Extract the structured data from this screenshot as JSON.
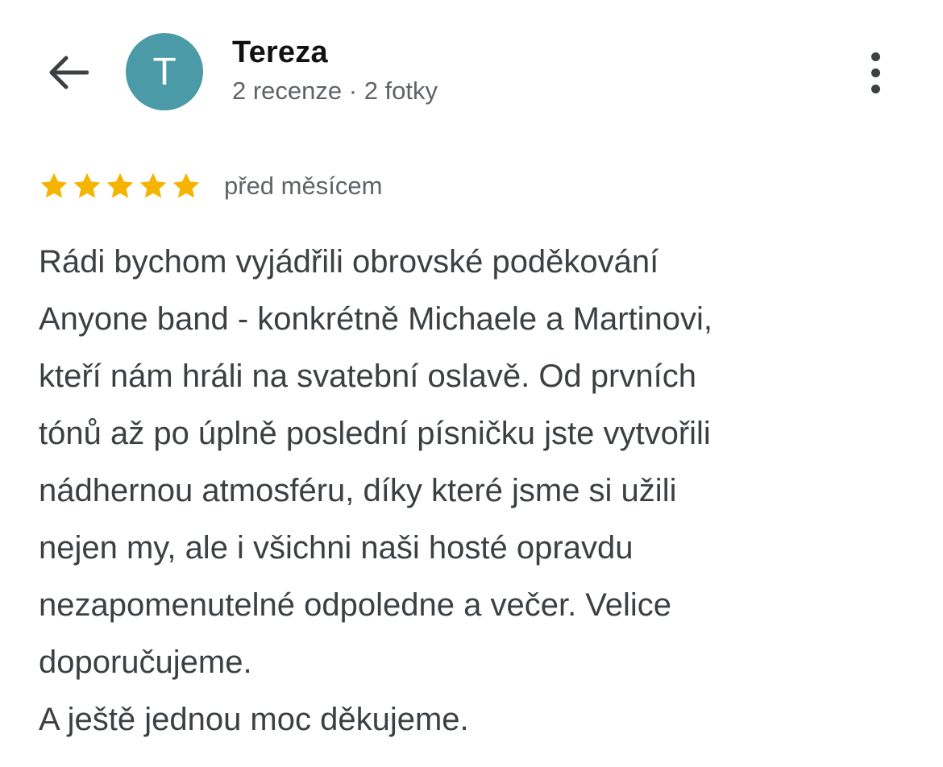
{
  "header": {
    "user_name": "Tereza",
    "avatar_letter": "T",
    "avatar_color": "#4a9aa8",
    "meta": "2 recenze · 2 fotky",
    "back_icon": "arrow-back-icon",
    "more_icon": "more-vert-icon"
  },
  "review": {
    "rating": 5,
    "max_rating": 5,
    "star_color": "#f4b400",
    "date": "před měsícem",
    "lines": [
      "Rádi bychom vyjádřili obrovské poděkování",
      "Anyone band - konkrétně Michaele a Martinovi,",
      "kteří nám hráli na svatební oslavě. Od prvních",
      "tónů až po úplně poslední písničku jste vytvořili",
      "nádhernou atmosféru, díky které jsme si užili",
      "nejen my, ale i všichni naši hosté opravdu",
      "nezapomenutelné odpoledne a večer. Velice",
      "doporučujeme.",
      "A ještě jednou moc děkujeme."
    ]
  }
}
